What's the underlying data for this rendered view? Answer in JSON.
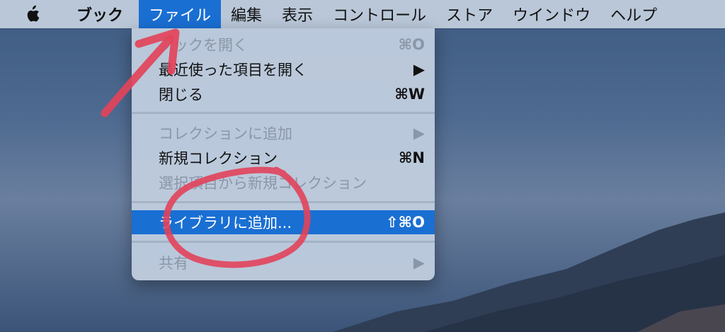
{
  "menubar": {
    "apple_icon": "apple-logo-icon",
    "app_name": "ブック",
    "items": [
      "ファイル",
      "編集",
      "表示",
      "コントロール",
      "ストア",
      "ウインドウ",
      "ヘルプ"
    ]
  },
  "file_menu": {
    "open_book": {
      "label": "ブックを開く",
      "shortcut": "⌘O"
    },
    "open_recent": {
      "label": "最近使った項目を開く",
      "shortcut": "▶"
    },
    "close": {
      "label": "閉じる",
      "shortcut": "⌘W"
    },
    "add_to_collection": {
      "label": "コレクションに追加",
      "shortcut": "▶"
    },
    "new_collection": {
      "label": "新規コレクション",
      "shortcut": "⌘N"
    },
    "new_collection_from_selection": {
      "label": "選択項目から新規コレクション"
    },
    "add_to_library": {
      "label": "ライブラリに追加...",
      "shortcut": "⇧⌘O"
    },
    "share": {
      "label": "共有",
      "shortcut": "▶"
    }
  },
  "colors": {
    "menubar_bg": "#b9c7d8",
    "highlight": "#1a6fd3",
    "annotation": "#e2435a"
  }
}
